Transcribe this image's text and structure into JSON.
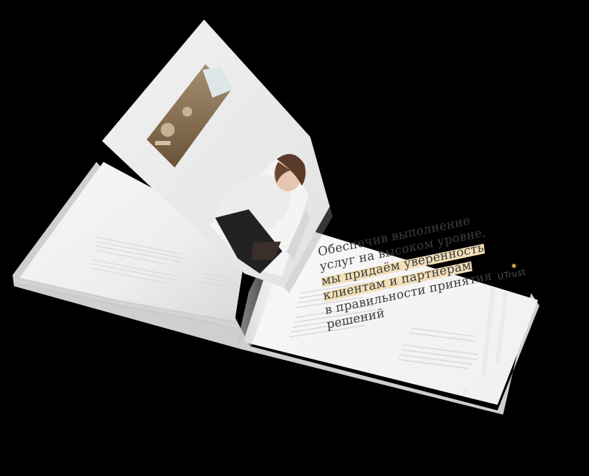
{
  "headline": {
    "lines": [
      "Обеспечив выполнение",
      "услуг на высоком уровне,",
      "мы придаём уверенность",
      "клиентам и партнерам",
      "в правильности принятия",
      "решений"
    ]
  },
  "brand": {
    "name": "UTrust",
    "accent_color": "#e5c24f"
  },
  "colors": {
    "background": "#000000",
    "paper": "#f4f4f4",
    "highlight": "#f2dfb8"
  }
}
